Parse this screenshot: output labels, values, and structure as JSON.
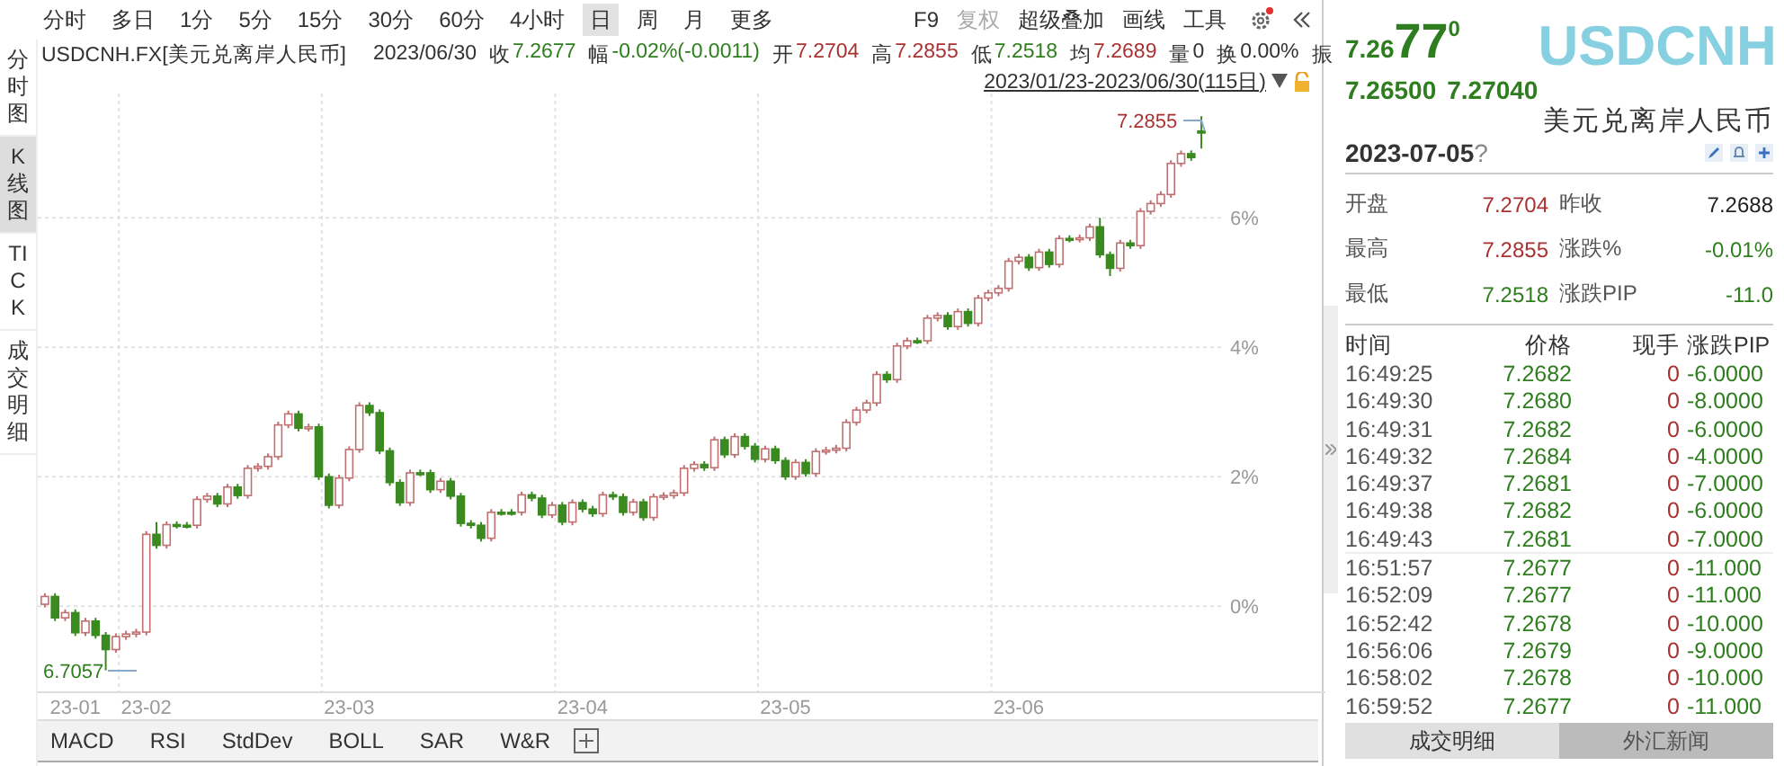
{
  "toolbar": {
    "periods": [
      {
        "label": "分时",
        "selected": false
      },
      {
        "label": "多日",
        "selected": false
      },
      {
        "label": "1分",
        "selected": false
      },
      {
        "label": "5分",
        "selected": false
      },
      {
        "label": "15分",
        "selected": false
      },
      {
        "label": "30分",
        "selected": false
      },
      {
        "label": "60分",
        "selected": false
      },
      {
        "label": "4小时",
        "selected": false
      },
      {
        "label": "日",
        "selected": true
      },
      {
        "label": "周",
        "selected": false
      },
      {
        "label": "月",
        "selected": false
      },
      {
        "label": "更多",
        "selected": false
      }
    ],
    "actions": [
      {
        "label": "F9",
        "disabled": false
      },
      {
        "label": "复权",
        "disabled": true
      },
      {
        "label": "超级叠加",
        "disabled": false
      },
      {
        "label": "画线",
        "disabled": false
      },
      {
        "label": "工具",
        "disabled": false
      }
    ]
  },
  "quote_line": {
    "symbol": "USDCNH.FX[美元兑离岸人民币]",
    "date": "2023/06/30",
    "fields": [
      {
        "label": "收",
        "value": "7.2677",
        "color": "#2e7d1e"
      },
      {
        "label": "幅",
        "value": "-0.02%(-0.0011)",
        "color": "#2e7d1e"
      },
      {
        "label": "开",
        "value": "7.2704",
        "color": "#a83232"
      },
      {
        "label": "高",
        "value": "7.2855",
        "color": "#a83232"
      },
      {
        "label": "低",
        "value": "7.2518",
        "color": "#2e7d1e"
      },
      {
        "label": "均",
        "value": "7.2689",
        "color": "#a83232"
      },
      {
        "label": "量",
        "value": "0",
        "color": "#333333"
      },
      {
        "label": "换",
        "value": "0.00%",
        "color": "#333333"
      },
      {
        "label": "振"
      }
    ]
  },
  "range": "2023/01/23-2023/06/30(115日)",
  "side_tabs": [
    {
      "label": "分时图",
      "selected": false
    },
    {
      "label": "K线图",
      "selected": true
    },
    {
      "label": "TICK",
      "selected": false
    },
    {
      "label": "成交明细",
      "selected": false
    }
  ],
  "chart": {
    "high_label": "7.2855",
    "low_label": "6.7057",
    "chart_data": {
      "type": "candlestick",
      "categories": [
        null,
        null,
        null,
        "23-01",
        null,
        null,
        null,
        null,
        null,
        null,
        "23-02",
        null,
        null,
        null,
        null,
        null,
        null,
        null,
        null,
        null,
        null,
        null,
        null,
        null,
        null,
        null,
        null,
        null,
        null,
        null,
        "23-03",
        null,
        null,
        null,
        null,
        null,
        null,
        null,
        null,
        null,
        null,
        null,
        null,
        null,
        null,
        null,
        null,
        null,
        null,
        null,
        null,
        null,
        null,
        "23-04",
        null,
        null,
        null,
        null,
        null,
        null,
        null,
        null,
        null,
        null,
        null,
        null,
        null,
        null,
        null,
        null,
        null,
        null,
        null,
        "23-05",
        null,
        null,
        null,
        null,
        null,
        null,
        null,
        null,
        null,
        null,
        null,
        null,
        null,
        null,
        null,
        null,
        null,
        null,
        null,
        null,
        null,
        null,
        "23-06",
        null,
        null,
        null,
        null,
        null,
        null,
        null,
        null,
        null,
        null,
        null,
        null,
        null,
        null,
        null,
        null,
        null,
        null
      ],
      "grid": true,
      "ylim": [
        -1.33,
        7.92
      ],
      "yticks": [
        {
          "value": 6,
          "label": "6%"
        },
        {
          "value": 4,
          "label": "4%"
        },
        {
          "value": 2,
          "label": "2%"
        },
        {
          "value": 0,
          "label": "0%"
        }
      ],
      "ohlc": [
        [
          0.03,
          0.2,
          -0.02,
          0.15
        ],
        [
          0.15,
          0.2,
          -0.23,
          -0.18
        ],
        [
          -0.18,
          -0.05,
          -0.23,
          -0.1
        ],
        [
          -0.1,
          -0.05,
          -0.46,
          -0.41
        ],
        [
          -0.41,
          -0.18,
          -0.46,
          -0.23
        ],
        [
          -0.23,
          -0.18,
          -0.5,
          -0.45
        ],
        [
          -0.45,
          -0.4,
          -0.99,
          -0.67
        ],
        [
          -0.67,
          -0.42,
          -0.72,
          -0.47
        ],
        [
          -0.47,
          -0.38,
          -0.52,
          -0.43
        ],
        [
          -0.43,
          -0.35,
          -0.48,
          -0.4
        ],
        [
          -0.4,
          1.16,
          -0.45,
          1.11
        ],
        [
          1.11,
          1.3,
          0.89,
          0.94
        ],
        [
          0.94,
          1.31,
          0.89,
          1.26
        ],
        [
          1.26,
          1.31,
          1.2,
          1.25
        ],
        [
          1.25,
          1.3,
          1.2,
          1.25
        ],
        [
          1.25,
          1.7,
          1.2,
          1.65
        ],
        [
          1.65,
          1.75,
          1.6,
          1.7
        ],
        [
          1.7,
          1.75,
          1.53,
          1.58
        ],
        [
          1.58,
          1.89,
          1.53,
          1.84
        ],
        [
          1.84,
          1.89,
          1.66,
          1.71
        ],
        [
          1.71,
          2.18,
          1.66,
          2.13
        ],
        [
          2.13,
          2.21,
          2.08,
          2.16
        ],
        [
          2.16,
          2.36,
          2.11,
          2.31
        ],
        [
          2.31,
          2.85,
          2.26,
          2.8
        ],
        [
          2.8,
          3.02,
          2.75,
          2.97
        ],
        [
          2.97,
          3.02,
          2.7,
          2.75
        ],
        [
          2.75,
          2.82,
          2.7,
          2.77
        ],
        [
          2.77,
          2.82,
          1.95,
          2.0
        ],
        [
          2.0,
          2.05,
          1.51,
          1.56
        ],
        [
          1.56,
          2.03,
          1.51,
          1.98
        ],
        [
          1.98,
          2.47,
          1.93,
          2.42
        ],
        [
          2.42,
          3.15,
          2.37,
          3.1
        ],
        [
          3.1,
          3.15,
          2.94,
          2.99
        ],
        [
          2.99,
          3.04,
          2.35,
          2.4
        ],
        [
          2.4,
          2.45,
          1.86,
          1.91
        ],
        [
          1.91,
          1.96,
          1.55,
          1.6
        ],
        [
          1.6,
          2.11,
          1.55,
          2.06
        ],
        [
          2.06,
          2.11,
          2.01,
          2.06
        ],
        [
          2.06,
          2.11,
          1.75,
          1.8
        ],
        [
          1.8,
          1.98,
          1.75,
          1.93
        ],
        [
          1.93,
          1.98,
          1.65,
          1.7
        ],
        [
          1.7,
          1.75,
          1.23,
          1.28
        ],
        [
          1.28,
          1.33,
          1.2,
          1.25
        ],
        [
          1.25,
          1.3,
          1.0,
          1.05
        ],
        [
          1.05,
          1.5,
          1.0,
          1.45
        ],
        [
          1.45,
          1.5,
          1.4,
          1.45
        ],
        [
          1.45,
          1.5,
          1.4,
          1.45
        ],
        [
          1.45,
          1.77,
          1.4,
          1.72
        ],
        [
          1.72,
          1.77,
          1.62,
          1.67
        ],
        [
          1.67,
          1.72,
          1.36,
          1.41
        ],
        [
          1.41,
          1.61,
          1.36,
          1.56
        ],
        [
          1.56,
          1.61,
          1.25,
          1.3
        ],
        [
          1.3,
          1.65,
          1.25,
          1.6
        ],
        [
          1.6,
          1.65,
          1.45,
          1.5
        ],
        [
          1.5,
          1.55,
          1.38,
          1.43
        ],
        [
          1.43,
          1.77,
          1.38,
          1.72
        ],
        [
          1.72,
          1.77,
          1.64,
          1.69
        ],
        [
          1.69,
          1.74,
          1.4,
          1.45
        ],
        [
          1.45,
          1.66,
          1.4,
          1.61
        ],
        [
          1.61,
          1.66,
          1.32,
          1.37
        ],
        [
          1.37,
          1.74,
          1.32,
          1.69
        ],
        [
          1.69,
          1.76,
          1.64,
          1.71
        ],
        [
          1.71,
          1.8,
          1.66,
          1.75
        ],
        [
          1.75,
          2.18,
          1.7,
          2.13
        ],
        [
          2.13,
          2.24,
          2.08,
          2.19
        ],
        [
          2.19,
          2.24,
          2.09,
          2.14
        ],
        [
          2.14,
          2.62,
          2.09,
          2.57
        ],
        [
          2.57,
          2.62,
          2.29,
          2.34
        ],
        [
          2.34,
          2.67,
          2.29,
          2.62
        ],
        [
          2.62,
          2.67,
          2.42,
          2.47
        ],
        [
          2.47,
          2.52,
          2.22,
          2.27
        ],
        [
          2.27,
          2.48,
          2.22,
          2.43
        ],
        [
          2.43,
          2.48,
          2.2,
          2.25
        ],
        [
          2.25,
          2.3,
          1.95,
          2.0
        ],
        [
          2.0,
          2.27,
          1.95,
          2.22
        ],
        [
          2.22,
          2.27,
          2.0,
          2.05
        ],
        [
          2.05,
          2.44,
          2.0,
          2.39
        ],
        [
          2.39,
          2.46,
          2.34,
          2.41
        ],
        [
          2.41,
          2.49,
          2.36,
          2.44
        ],
        [
          2.44,
          2.89,
          2.39,
          2.84
        ],
        [
          2.84,
          3.08,
          2.79,
          3.03
        ],
        [
          3.03,
          3.19,
          2.98,
          3.14
        ],
        [
          3.14,
          3.63,
          3.09,
          3.58
        ],
        [
          3.58,
          3.63,
          3.45,
          3.5
        ],
        [
          3.5,
          4.07,
          3.45,
          4.02
        ],
        [
          4.02,
          4.15,
          3.97,
          4.1
        ],
        [
          4.1,
          4.15,
          4.05,
          4.1
        ],
        [
          4.1,
          4.5,
          4.05,
          4.45
        ],
        [
          4.45,
          4.54,
          4.4,
          4.49
        ],
        [
          4.49,
          4.54,
          4.27,
          4.32
        ],
        [
          4.32,
          4.6,
          4.27,
          4.55
        ],
        [
          4.55,
          4.6,
          4.32,
          4.37
        ],
        [
          4.37,
          4.81,
          4.32,
          4.76
        ],
        [
          4.76,
          4.89,
          4.71,
          4.84
        ],
        [
          4.84,
          4.96,
          4.79,
          4.91
        ],
        [
          4.91,
          5.38,
          4.86,
          5.33
        ],
        [
          5.33,
          5.44,
          5.28,
          5.39
        ],
        [
          5.39,
          5.44,
          5.18,
          5.23
        ],
        [
          5.23,
          5.52,
          5.18,
          5.47
        ],
        [
          5.47,
          5.52,
          5.23,
          5.28
        ],
        [
          5.28,
          5.73,
          5.23,
          5.68
        ],
        [
          5.68,
          5.73,
          5.62,
          5.67
        ],
        [
          5.67,
          5.74,
          5.62,
          5.69
        ],
        [
          5.69,
          5.91,
          5.64,
          5.86
        ],
        [
          5.86,
          6.0,
          5.38,
          5.43
        ],
        [
          5.43,
          5.48,
          5.1,
          5.22
        ],
        [
          5.22,
          5.66,
          5.17,
          5.61
        ],
        [
          5.61,
          5.66,
          5.52,
          5.57
        ],
        [
          5.57,
          6.15,
          5.52,
          6.1
        ],
        [
          6.1,
          6.27,
          6.05,
          6.22
        ],
        [
          6.22,
          6.41,
          6.17,
          6.36
        ],
        [
          6.36,
          6.89,
          6.31,
          6.84
        ],
        [
          6.84,
          7.04,
          6.79,
          6.99
        ],
        [
          6.99,
          7.04,
          6.88,
          6.93
        ],
        [
          7.34,
          7.57,
          7.07,
          7.31
        ]
      ]
    }
  },
  "indicator_tabs": [
    "MACD",
    "RSI",
    "StdDev",
    "BOLL",
    "SAR",
    "W&R"
  ],
  "quote": {
    "price_head": "7.26",
    "price_big": "77",
    "price_tail": "0",
    "bid": "7.26500",
    "ask": "7.27040",
    "code": "USDCNH",
    "name": "美元兑离岸人民币",
    "date": "2023-07-05",
    "date_mark": "?"
  },
  "stats": [
    {
      "label": "开盘",
      "value": "7.2704",
      "color": "#a83232"
    },
    {
      "label": "昨收",
      "value": "7.2688",
      "color": "#222222"
    },
    {
      "label": "最高",
      "value": "7.2855",
      "color": "#a83232"
    },
    {
      "label": "涨跌%",
      "value": "-0.01%",
      "color": "#2e7d1e"
    },
    {
      "label": "最低",
      "value": "7.2518",
      "color": "#2e7d1e"
    },
    {
      "label": "涨跌PIP",
      "value": "-11.0",
      "color": "#2e7d1e"
    }
  ],
  "trades": {
    "columns": [
      "时间",
      "价格",
      "现手",
      "涨跌PIP"
    ],
    "rows": [
      {
        "time": "16:49:25",
        "price": "7.2682",
        "volume": "0",
        "change": "-6.0000"
      },
      {
        "time": "16:49:30",
        "price": "7.2680",
        "volume": "0",
        "change": "-8.0000"
      },
      {
        "time": "16:49:31",
        "price": "7.2682",
        "volume": "0",
        "change": "-6.0000"
      },
      {
        "time": "16:49:32",
        "price": "7.2684",
        "volume": "0",
        "change": "-4.0000"
      },
      {
        "time": "16:49:37",
        "price": "7.2681",
        "volume": "0",
        "change": "-7.0000"
      },
      {
        "time": "16:49:38",
        "price": "7.2682",
        "volume": "0",
        "change": "-6.0000"
      },
      {
        "time": "16:49:43",
        "price": "7.2681",
        "volume": "0",
        "change": "-7.0000"
      },
      {
        "time": "16:51:57",
        "price": "7.2677",
        "volume": "0",
        "change": "-11.000"
      },
      {
        "time": "16:52:09",
        "price": "7.2677",
        "volume": "0",
        "change": "-11.000"
      },
      {
        "time": "16:52:42",
        "price": "7.2678",
        "volume": "0",
        "change": "-10.000"
      },
      {
        "time": "16:56:06",
        "price": "7.2679",
        "volume": "0",
        "change": "-9.0000"
      },
      {
        "time": "16:58:02",
        "price": "7.2678",
        "volume": "0",
        "change": "-10.000"
      },
      {
        "time": "16:59:52",
        "price": "7.2677",
        "volume": "0",
        "change": "-11.000"
      }
    ]
  },
  "bottom_tabs": [
    {
      "label": "成交明细",
      "selected": true
    },
    {
      "label": "外汇新闻",
      "selected": false
    }
  ]
}
